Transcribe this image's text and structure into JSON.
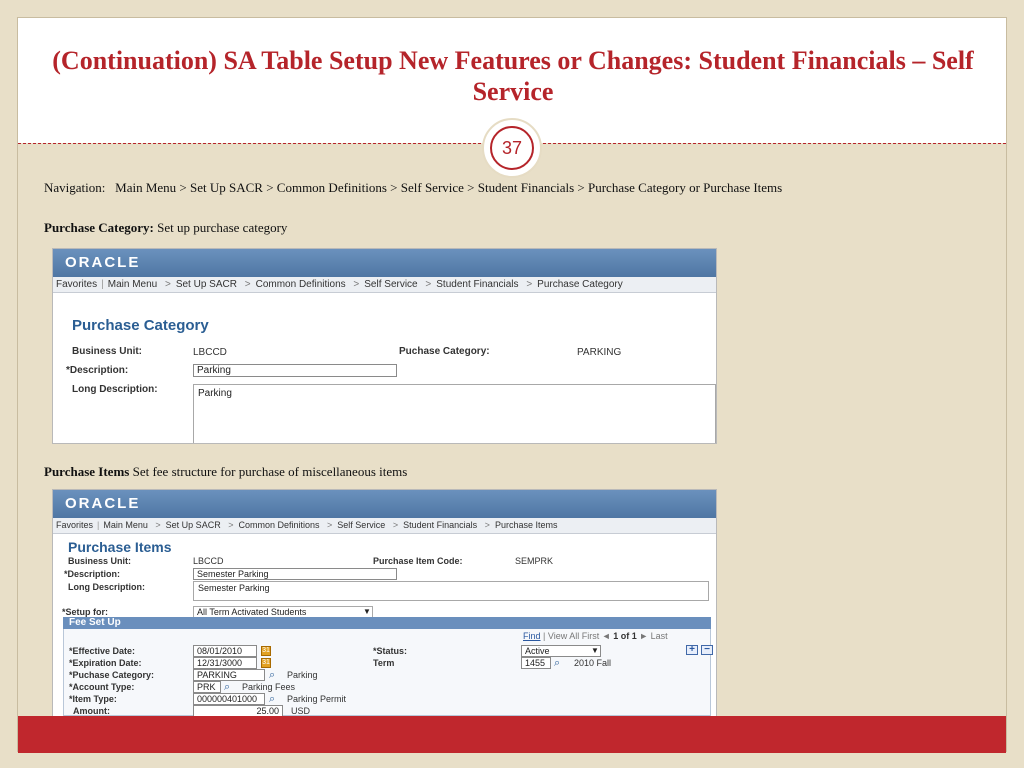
{
  "slide": {
    "title": "(Continuation) SA Table Setup New Features or Changes: Student Financials – Self Service",
    "page_number": "37",
    "navigation_label": "Navigation:",
    "navigation_path": "Main Menu > Set Up SACR > Common Definitions > Self Service > Student Financials > Purchase Category or Purchase Items",
    "section1_heading": "Purchase Category:",
    "section1_text": " Set up purchase category",
    "section2_heading": "Purchase Items",
    "section2_text": " Set fee structure for purchase  of miscellaneous items"
  },
  "colors": {
    "accent": "#b5242a",
    "background": "#e8dfc8",
    "oracle_bar": "#5a80ad",
    "ps_title": "#2b5e93"
  },
  "shot1": {
    "logo": "ORACLE",
    "nav": {
      "favorites": "Favorites",
      "main_menu": "Main Menu",
      "sep": ">",
      "crumbs": [
        "Set Up SACR",
        "Common Definitions",
        "Self Service",
        "Student Financials",
        "Purchase Category"
      ]
    },
    "page_title": "Purchase Category",
    "business_unit_label": "Business Unit:",
    "business_unit_value": "LBCCD",
    "category_label": "Puchase Category:",
    "category_value": "PARKING",
    "description_label": "*Description:",
    "description_value": "Parking",
    "long_description_label": "Long Description:",
    "long_description_value": "Parking"
  },
  "shot2": {
    "logo": "ORACLE",
    "nav": {
      "favorites": "Favorites",
      "main_menu": "Main Menu",
      "sep": ">",
      "crumbs": [
        "Set Up SACR",
        "Common Definitions",
        "Self Service",
        "Student Financials",
        "Purchase Items"
      ]
    },
    "page_title": "Purchase Items",
    "business_unit_label": "Business Unit:",
    "business_unit_value": "LBCCD",
    "item_code_label": "Purchase Item Code:",
    "item_code_value": "SEMPRK",
    "description_label": "*Description:",
    "description_value": "Semester Parking",
    "long_description_label": "Long Description:",
    "long_description_value": "Semester Parking",
    "setup_for_label": "*Setup for:",
    "setup_for_value": "All Term Activated Students",
    "fee_setup_header": "Fee Set Up",
    "grid_nav": {
      "find": "Find",
      "view_all": "View All",
      "first": "First",
      "counter": "1 of 1",
      "last": "Last"
    },
    "effective_date_label": "*Effective Date:",
    "effective_date_value": "08/01/2010",
    "expiration_date_label": "*Expiration Date:",
    "expiration_date_value": "12/31/3000",
    "purchase_category_label": "*Puchase Category:",
    "purchase_category_value": "PARKING",
    "purchase_category_desc": "Parking",
    "account_type_label": "*Account Type:",
    "account_type_value": "PRK",
    "account_type_desc": "Parking Fees",
    "item_type_label": "*Item Type:",
    "item_type_value": "000000401000",
    "item_type_desc": "Parking Permit",
    "amount_label": "Amount:",
    "amount_value": "25.00",
    "currency": "USD",
    "status_label": "*Status:",
    "status_value": "Active",
    "term_label": "Term",
    "term_value": "1455",
    "term_desc": "2010 Fall"
  }
}
